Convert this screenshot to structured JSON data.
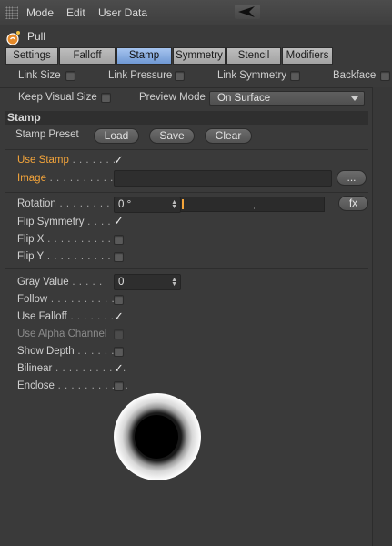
{
  "menubar": {
    "items": [
      "Mode",
      "Edit",
      "User Data"
    ]
  },
  "object": {
    "name": "Pull",
    "icon": "pull-brush-icon"
  },
  "tabs": [
    {
      "label": "Settings",
      "active": false
    },
    {
      "label": "Falloff",
      "active": false
    },
    {
      "label": "Stamp",
      "active": true
    },
    {
      "label": "Symmetry",
      "active": false
    },
    {
      "label": "Stencil",
      "active": false
    },
    {
      "label": "Modifiers",
      "active": false
    }
  ],
  "links": {
    "link_size": "Link Size",
    "link_pressure": "Link Pressure",
    "link_symmetry": "Link Symmetry",
    "backface": "Backface"
  },
  "keep_visual_size": "Keep Visual Size",
  "preview_mode": {
    "label": "Preview Mode",
    "value": "On Surface"
  },
  "section_title": "Stamp",
  "stamp_preset": {
    "label": "Stamp Preset",
    "load": "Load",
    "save": "Save",
    "clear": "Clear"
  },
  "params": {
    "use_stamp": "Use Stamp",
    "image": "Image",
    "image_button": "...",
    "rotation": "Rotation",
    "rotation_value": "0 °",
    "fx_button": "fx",
    "flip_symmetry": "Flip Symmetry",
    "flip_x": "Flip X",
    "flip_y": "Flip Y",
    "gray_value": "Gray Value",
    "gray_value_value": "0",
    "follow": "Follow",
    "use_falloff": "Use Falloff",
    "use_alpha_channel": "Use Alpha Channel",
    "show_depth": "Show Depth",
    "bilinear": "Bilinear",
    "enclose": "Enclose"
  },
  "checks": {
    "use_stamp": true,
    "flip_symmetry": true,
    "flip_x": false,
    "flip_y": false,
    "follow": false,
    "use_falloff": true,
    "use_alpha_channel": false,
    "show_depth": false,
    "bilinear": true,
    "enclose": false
  },
  "checkmark_glyph": "✓",
  "colors": {
    "accent": "#f3a43a",
    "active_tab": "#8fb1e3"
  }
}
